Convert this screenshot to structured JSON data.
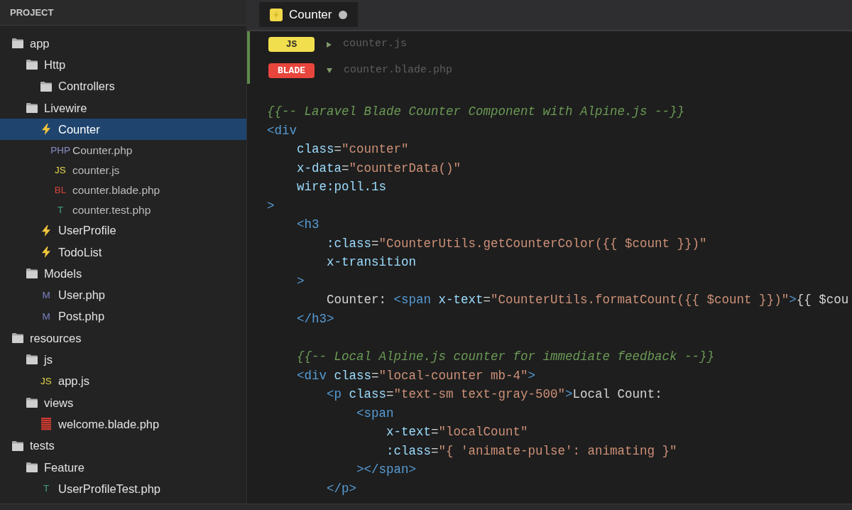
{
  "sidebar": {
    "title": "PROJECT",
    "tree": [
      {
        "label": "app",
        "kind": "folder",
        "selected": false,
        "children": [
          {
            "label": "Http",
            "kind": "folder",
            "selected": false,
            "children": [
              {
                "label": "Controllers",
                "kind": "folder",
                "selected": false
              }
            ]
          },
          {
            "label": "Livewire",
            "kind": "folder",
            "selected": false,
            "children": [
              {
                "label": "Counter",
                "kind": "component",
                "selected": true,
                "children": [
                  {
                    "label": "Counter.php",
                    "kind": "badge",
                    "badge": "PHP",
                    "color": "#8a8dc6",
                    "selected": false
                  },
                  {
                    "label": "counter.js",
                    "kind": "badge",
                    "badge": "JS",
                    "color": "#e8d84c",
                    "selected": false
                  },
                  {
                    "label": "counter.blade.php",
                    "kind": "badge",
                    "badge": "BL",
                    "color": "#d8433a",
                    "selected": false
                  },
                  {
                    "label": "counter.test.php",
                    "kind": "badge",
                    "badge": "T",
                    "color": "#3fa57f",
                    "selected": false
                  }
                ]
              },
              {
                "label": "UserProfile",
                "kind": "component",
                "selected": false
              },
              {
                "label": "TodoList",
                "kind": "component",
                "selected": false
              }
            ]
          },
          {
            "label": "Models",
            "kind": "folder",
            "selected": false,
            "children": [
              {
                "label": "User.php",
                "kind": "badge",
                "badge": "M",
                "color": "#7c80c4",
                "selected": false
              },
              {
                "label": "Post.php",
                "kind": "badge",
                "badge": "M",
                "color": "#7c80c4",
                "selected": false
              }
            ]
          }
        ]
      },
      {
        "label": "resources",
        "kind": "folder",
        "selected": false,
        "children": [
          {
            "label": "js",
            "kind": "folder",
            "selected": false,
            "children": [
              {
                "label": "app.js",
                "kind": "badge",
                "badge": "JS",
                "color": "#e8d84c",
                "selected": false
              }
            ]
          },
          {
            "label": "views",
            "kind": "folder",
            "selected": false,
            "children": [
              {
                "label": "welcome.blade.php",
                "kind": "blade-file",
                "selected": false
              }
            ]
          }
        ]
      },
      {
        "label": "tests",
        "kind": "folder",
        "selected": false,
        "children": [
          {
            "label": "Feature",
            "kind": "folder",
            "selected": false,
            "children": [
              {
                "label": "UserProfileTest.php",
                "kind": "badge",
                "badge": "T",
                "color": "#3fa57f",
                "selected": false
              }
            ]
          }
        ]
      }
    ]
  },
  "tabs": [
    {
      "label": "Counter",
      "selected": true,
      "modified": true
    }
  ],
  "files": [
    {
      "tag": "JS",
      "color": "#f2df4e",
      "expanded": false,
      "name": "counter.js"
    },
    {
      "tag": "BLADE",
      "color": "#e8453c",
      "expanded": true,
      "name": "counter.blade.php"
    }
  ],
  "code": [
    {
      "kind": "code",
      "segments": [
        {
          "kind": "comment",
          "text": "{{-- Laravel Blade Counter Component with Alpine.js --}}"
        }
      ]
    },
    {
      "kind": "code",
      "segments": [
        {
          "kind": "tag",
          "text": "<div"
        }
      ],
      "children": [
        {
          "kind": "code",
          "segments": [
            {
              "kind": "attr",
              "text": "class"
            },
            {
              "kind": "punct",
              "text": "="
            },
            {
              "kind": "string",
              "text": "\"counter\""
            }
          ]
        },
        {
          "kind": "code",
          "segments": [
            {
              "kind": "attr",
              "text": "x-data"
            },
            {
              "kind": "punct",
              "text": "="
            },
            {
              "kind": "string",
              "text": "\"counterData()\""
            }
          ]
        },
        {
          "kind": "code",
          "segments": [
            {
              "kind": "attr",
              "text": "wire:poll.1s"
            }
          ]
        }
      ]
    },
    {
      "kind": "code",
      "segments": [
        {
          "kind": "tag",
          "text": ">"
        }
      ],
      "children": [
        {
          "kind": "code",
          "segments": [
            {
              "kind": "tag",
              "text": "<h3"
            }
          ],
          "children": [
            {
              "kind": "code",
              "segments": [
                {
                  "kind": "attr",
                  "text": ":class"
                },
                {
                  "kind": "punct",
                  "text": "="
                },
                {
                  "kind": "string",
                  "text": "\"CounterUtils.getCounterColor({{ $count }})\""
                }
              ]
            },
            {
              "kind": "code",
              "segments": [
                {
                  "kind": "attr",
                  "text": "x-transition"
                }
              ]
            }
          ]
        },
        {
          "kind": "code",
          "segments": [
            {
              "kind": "tag",
              "text": ">"
            }
          ],
          "children": [
            {
              "kind": "code",
              "segments": [
                {
                  "kind": "text",
                  "text": "Counter: "
                },
                {
                  "kind": "tag",
                  "text": "<span"
                },
                {
                  "kind": "attr",
                  "text": " x-text"
                },
                {
                  "kind": "punct",
                  "text": "="
                },
                {
                  "kind": "string",
                  "text": "\"CounterUtils.formatCount({{ $count }})\""
                },
                {
                  "kind": "tag",
                  "text": ">"
                },
                {
                  "kind": "text",
                  "text": "{{ $cou"
                }
              ]
            }
          ]
        },
        {
          "kind": "code",
          "segments": [
            {
              "kind": "tag",
              "text": "</h3>"
            }
          ]
        },
        {
          "kind": "blank"
        },
        {
          "kind": "code",
          "segments": [
            {
              "kind": "comment",
              "text": "{{-- Local Alpine.js counter for immediate feedback --}}"
            }
          ]
        },
        {
          "kind": "code",
          "segments": [
            {
              "kind": "tag",
              "text": "<div"
            },
            {
              "kind": "attr",
              "text": " class"
            },
            {
              "kind": "punct",
              "text": "="
            },
            {
              "kind": "string",
              "text": "\"local-counter mb-4\""
            },
            {
              "kind": "tag",
              "text": ">"
            }
          ],
          "children": [
            {
              "kind": "code",
              "segments": [
                {
                  "kind": "tag",
                  "text": "<p"
                },
                {
                  "kind": "attr",
                  "text": " class"
                },
                {
                  "kind": "punct",
                  "text": "="
                },
                {
                  "kind": "string",
                  "text": "\"text-sm text-gray-500\""
                },
                {
                  "kind": "tag",
                  "text": ">"
                },
                {
                  "kind": "text",
                  "text": "Local Count:"
                }
              ],
              "children": [
                {
                  "kind": "code",
                  "segments": [
                    {
                      "kind": "tag",
                      "text": "<span"
                    }
                  ],
                  "children": [
                    {
                      "kind": "code",
                      "segments": [
                        {
                          "kind": "attr",
                          "text": "x-text"
                        },
                        {
                          "kind": "punct",
                          "text": "="
                        },
                        {
                          "kind": "string",
                          "text": "\"localCount\""
                        }
                      ]
                    },
                    {
                      "kind": "code",
                      "segments": [
                        {
                          "kind": "attr",
                          "text": ":class"
                        },
                        {
                          "kind": "punct",
                          "text": "="
                        },
                        {
                          "kind": "string",
                          "text": "\"{ 'animate-pulse': animating }\""
                        }
                      ]
                    }
                  ]
                },
                {
                  "kind": "code",
                  "segments": [
                    {
                      "kind": "tag",
                      "text": "></span>"
                    }
                  ]
                }
              ]
            },
            {
              "kind": "code",
              "segments": [
                {
                  "kind": "tag",
                  "text": "</p>"
                }
              ]
            }
          ]
        }
      ]
    }
  ]
}
